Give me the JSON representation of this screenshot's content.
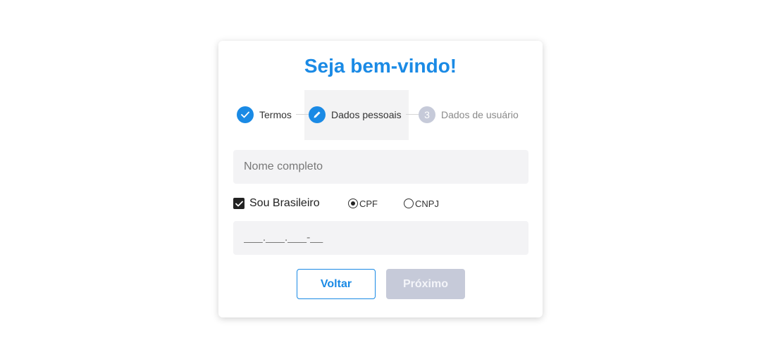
{
  "title": "Seja bem-vindo!",
  "stepper": {
    "steps": [
      {
        "label": "Termos",
        "state": "done",
        "icon": "check-icon"
      },
      {
        "label": "Dados pessoais",
        "state": "active",
        "icon": "pencil-icon"
      },
      {
        "label": "Dados de usuário",
        "state": "pending",
        "number": "3"
      }
    ]
  },
  "form": {
    "name_placeholder": "Nome completo",
    "brasileiro_label": "Sou Brasileiro",
    "brasileiro_checked": true,
    "doc_type_options": [
      "CPF",
      "CNPJ"
    ],
    "doc_type_selected": "CPF",
    "doc_mask": "___.___.___-__"
  },
  "buttons": {
    "back_label": "Voltar",
    "next_label": "Próximo"
  },
  "colors": {
    "accent": "#1a8ae5",
    "disabled": "#c6cad9",
    "field_bg": "#f3f3f5"
  }
}
